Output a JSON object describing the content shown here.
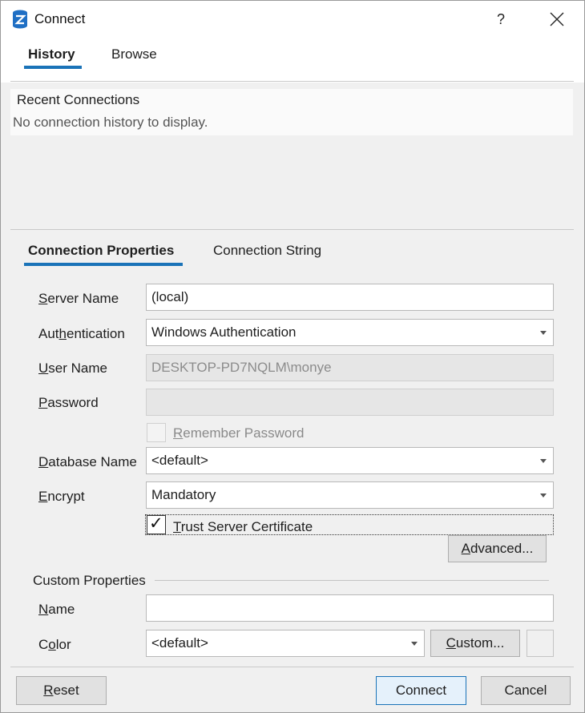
{
  "window": {
    "title": "Connect",
    "help_label": "?"
  },
  "top_tabs": [
    {
      "label": "History",
      "active": true
    },
    {
      "label": "Browse",
      "active": false
    }
  ],
  "recent": {
    "title": "Recent Connections",
    "empty_text": "No connection history to display."
  },
  "inner_tabs": [
    {
      "label": "Connection Properties",
      "active": true
    },
    {
      "label": "Connection String",
      "active": false
    }
  ],
  "form": {
    "server_name": {
      "label_pre": "",
      "label_key": "S",
      "label_post": "erver Name",
      "value": "(local)"
    },
    "authentication": {
      "label_pre": "Aut",
      "label_key": "h",
      "label_post": "entication",
      "value": "Windows Authentication"
    },
    "user_name": {
      "label_pre": "",
      "label_key": "U",
      "label_post": "ser Name",
      "value": "DESKTOP-PD7NQLM\\monye"
    },
    "password": {
      "label_pre": "",
      "label_key": "P",
      "label_post": "assword",
      "value": ""
    },
    "remember_password": {
      "label_pre": "",
      "label_key": "R",
      "label_post": "emember Password",
      "checked": false
    },
    "database_name": {
      "label_pre": "",
      "label_key": "D",
      "label_post": "atabase Name",
      "value": "<default>"
    },
    "encrypt": {
      "label_pre": "",
      "label_key": "E",
      "label_post": "ncrypt",
      "value": "Mandatory"
    },
    "trust_cert": {
      "label_pre": "",
      "label_key": "T",
      "label_post": "rust Server Certificate",
      "checked": true,
      "check_glyph": "✓"
    },
    "advanced_button": {
      "label_pre": "",
      "label_key": "A",
      "label_post": "dvanced..."
    }
  },
  "custom": {
    "title": "Custom Properties",
    "name": {
      "label_pre": "",
      "label_key": "N",
      "label_post": "ame",
      "value": ""
    },
    "color": {
      "label_pre": "C",
      "label_key": "o",
      "label_post": "lor",
      "value": "<default>"
    },
    "custom_button": {
      "label_pre": "",
      "label_key": "C",
      "label_post": "ustom..."
    }
  },
  "footer": {
    "reset": {
      "label_pre": "",
      "label_key": "R",
      "label_post": "eset"
    },
    "connect": {
      "label": "Connect"
    },
    "cancel": {
      "label": "Cancel"
    }
  },
  "colors": {
    "accent": "#1a73b8",
    "app_icon": "#1f6fc4"
  },
  "icons": {
    "app": "database-icon",
    "close": "close-icon",
    "dropdown": "chevron-down-icon"
  }
}
